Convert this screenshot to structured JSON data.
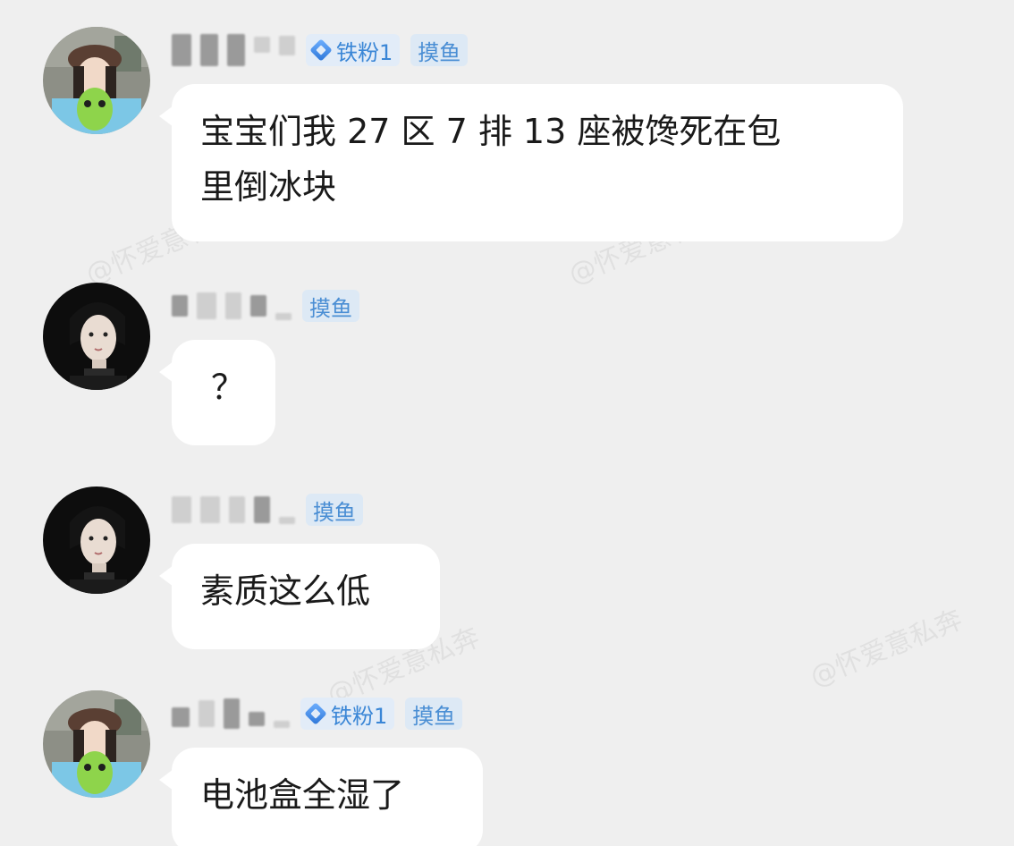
{
  "watermark": "@怀爱意私奔",
  "badges": {
    "fan_label": "铁粉1",
    "fish_label": "摸鱼"
  },
  "messages": [
    {
      "avatar": "girl-hat-avatar",
      "has_fan_badge": true,
      "text_line1": "宝宝们我 27 区 7 排 13 座被馋死在包",
      "text_line2": "里倒冰块"
    },
    {
      "avatar": "dark-portrait-avatar",
      "has_fan_badge": false,
      "text_line1": "？"
    },
    {
      "avatar": "dark-portrait-avatar",
      "has_fan_badge": false,
      "text_line1": "素质这么低"
    },
    {
      "avatar": "girl-hat-avatar",
      "has_fan_badge": true,
      "text_line1": "电池盒全湿了"
    }
  ]
}
